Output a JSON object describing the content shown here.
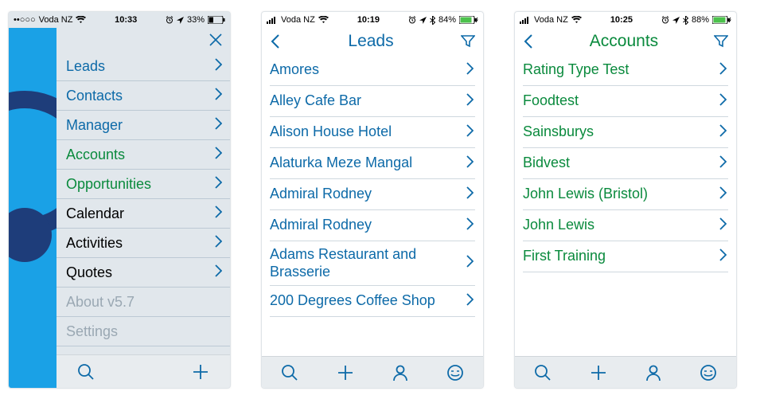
{
  "phones": [
    {
      "status": {
        "carrier": "Voda NZ",
        "time": "10:33",
        "battery": "33%",
        "signal_type": "dots"
      },
      "menu": [
        {
          "label": "Leads",
          "color": "blue",
          "chev": true
        },
        {
          "label": "Contacts",
          "color": "blue",
          "chev": true
        },
        {
          "label": "Manager",
          "color": "blue",
          "chev": true
        },
        {
          "label": "Accounts",
          "color": "green",
          "chev": true
        },
        {
          "label": "Opportunities",
          "color": "green",
          "chev": true
        },
        {
          "label": "Calendar",
          "color": "black",
          "chev": true
        },
        {
          "label": "Activities",
          "color": "black",
          "chev": true
        },
        {
          "label": "Quotes",
          "color": "black",
          "chev": true
        },
        {
          "label": "About v5.7",
          "color": "grey",
          "chev": false
        },
        {
          "label": "Settings",
          "color": "grey",
          "chev": false
        }
      ]
    },
    {
      "status": {
        "carrier": "Voda NZ",
        "time": "10:19",
        "battery": "84%",
        "signal_type": "bars"
      },
      "title": "Leads",
      "text_color": "blue",
      "rows": [
        "Amores",
        "Alley Cafe Bar",
        "Alison House Hotel",
        "Alaturka Meze Mangal",
        "Admiral Rodney",
        "Admiral Rodney",
        "Adams Restaurant and Brasserie",
        "200 Degrees Coffee Shop"
      ]
    },
    {
      "status": {
        "carrier": "Voda NZ",
        "time": "10:25",
        "battery": "88%",
        "signal_type": "bars"
      },
      "title": "Accounts",
      "text_color": "green",
      "rows": [
        "Rating Type Test",
        "Foodtest",
        "Sainsburys",
        "Bidvest",
        "John Lewis (Bristol)",
        "John Lewis",
        "First Training"
      ]
    }
  ]
}
